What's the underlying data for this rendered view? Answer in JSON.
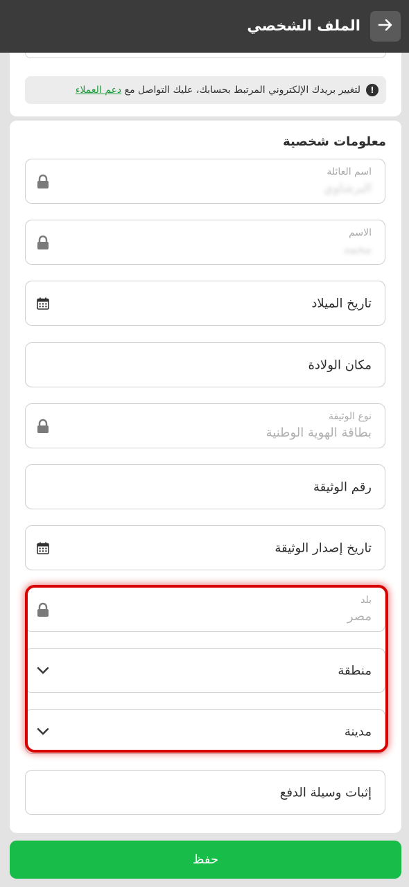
{
  "header": {
    "title": "الملف الشخصي"
  },
  "notice": {
    "text": "لتغيير بريدك الإلكتروني المرتبط بحسابك، عليك التواصل مع",
    "link_text": "دعم العملاء"
  },
  "personal_info": {
    "section_title": "معلومات شخصية",
    "family_name": {
      "label": "اسم العائلة",
      "value": "البرشاوي"
    },
    "first_name": {
      "label": "الاسم",
      "value": "محمد"
    },
    "birth_date": {
      "placeholder": "تاريخ الميلاد"
    },
    "birth_place": {
      "placeholder": "مكان الولادة"
    },
    "document_type": {
      "label": "نوع الوثيقة",
      "value": "بطاقة الهوية الوطنية"
    },
    "document_number": {
      "placeholder": "رقم الوثيقة"
    },
    "document_issue_date": {
      "placeholder": "تاريخ إصدار الوثيقة"
    },
    "country": {
      "label": "بلد",
      "value": "مصر"
    },
    "region": {
      "placeholder": "منطقة"
    },
    "city": {
      "placeholder": "مدينة"
    },
    "payment_proof": {
      "placeholder": "إثبات وسيلة الدفع"
    }
  },
  "save_button": {
    "label": "حفظ"
  },
  "colors": {
    "header_bg": "#3b3b3b",
    "save_green": "#17bd48",
    "link_green": "#1a9a3a",
    "highlight_red": "#d90000"
  },
  "icons": {
    "back": "arrow-right-icon",
    "notice": "exclamation-circle-icon",
    "lock": "lock-icon",
    "calendar": "calendar-icon",
    "dropdown": "chevron-down-icon"
  }
}
